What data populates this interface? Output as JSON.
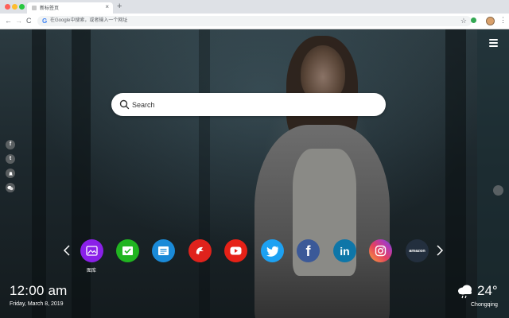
{
  "browser": {
    "traffic_colors": [
      "#ff5f57",
      "#febc2e",
      "#28c840"
    ],
    "tab_title": "新标签页",
    "tab_close": "×",
    "new_tab": "+",
    "back": "←",
    "forward": "→",
    "reload": "C",
    "google_g": "G",
    "omnibox_placeholder": "在Google中搜索，或者输入一个网址",
    "star": "☆",
    "menu": "⋮"
  },
  "search": {
    "placeholder": "Search"
  },
  "social": [
    {
      "icon": "facebook-icon",
      "glyph": "f"
    },
    {
      "icon": "twitter-icon",
      "glyph": "t"
    },
    {
      "icon": "bell-icon",
      "glyph": ""
    },
    {
      "icon": "chat-icon",
      "glyph": ""
    }
  ],
  "dock": {
    "apps": [
      {
        "icon": "gallery-icon",
        "color": "#8a20e8",
        "label": "图库"
      },
      {
        "icon": "checkmark-icon",
        "color": "#21b521",
        "label": ""
      },
      {
        "icon": "notes-icon",
        "color": "#1a8ad8",
        "label": ""
      },
      {
        "icon": "game-icon",
        "color": "#e0221c",
        "label": ""
      },
      {
        "icon": "youtube-icon",
        "color": "#e62117",
        "label": ""
      },
      {
        "icon": "twitter-icon",
        "color": "#1da1f2",
        "label": ""
      },
      {
        "icon": "facebook-icon",
        "color": "#3b5998",
        "label": ""
      },
      {
        "icon": "linkedin-icon",
        "color": "#0e76a8",
        "label": ""
      },
      {
        "icon": "instagram-icon",
        "color": "#c13584",
        "label": ""
      },
      {
        "icon": "amazon-icon",
        "color": "#232f3e",
        "label": ""
      }
    ],
    "linkedin_text": "in",
    "facebook_text": "f",
    "amazon_text": "amazon"
  },
  "clock": {
    "time": "12:00 am",
    "date": "Friday, March 8, 2019"
  },
  "weather": {
    "temperature": "24°",
    "city": "Chongqing"
  }
}
